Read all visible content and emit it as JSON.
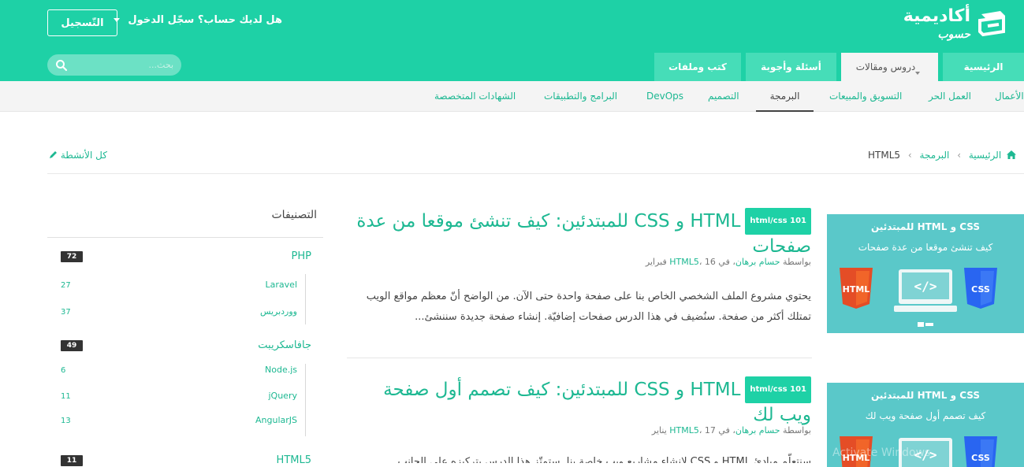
{
  "brand": {
    "name_line1": "أكاديمية",
    "name_line2": "حسوب"
  },
  "header": {
    "login_prompt": "هل لديك حساب؟ سجّل الدخول",
    "signup_label": "التّسجيل",
    "search_placeholder": "بحث..."
  },
  "main_tabs": [
    {
      "label": "الرئيسية",
      "active": false
    },
    {
      "label": "دروس ومقالات",
      "active": true
    },
    {
      "label": "أسئلة وأجوبة",
      "active": false
    },
    {
      "label": "كتب وملفات",
      "active": false
    }
  ],
  "sub_nav": [
    {
      "label": "الأعمال",
      "active": false
    },
    {
      "label": "العمل الحر",
      "active": false
    },
    {
      "label": "التسويق والمبيعات",
      "active": false
    },
    {
      "label": "البرمجة",
      "active": true
    },
    {
      "label": "التصميم",
      "active": false
    },
    {
      "label": "DevOps",
      "active": false
    },
    {
      "label": "البرامج والتطبيقات",
      "active": false
    },
    {
      "label": "الشهادات المتخصصة",
      "active": false
    }
  ],
  "breadcrumb": {
    "home": "الرئيسية",
    "section": "البرمجة",
    "current": "HTML5"
  },
  "all_activity_label": "كل الأنشطة",
  "articles": [
    {
      "tag": "html/css 101",
      "title": "HTML و CSS للمبتدئين: كيف تنشئ موقعا من عدة صفحات",
      "meta_by": "بواسطة",
      "author": "حسام برهان",
      "meta_in": "، في",
      "category": "HTML5",
      "date": "، 16 فبراير",
      "excerpt": "يحتوي مشروع الملف الشخصي الخاص بنا على صفحة واحدة حتى الآن. من الواضح أنّ معظم مواقع الويب تمتلك أكثر من صفحة. سنُضيف في هذا الدرس صفحات إضافيّة. إنشاء صفحة جديدة سننشئ...",
      "thumb_title": "CSS و HTML للمبتدئين",
      "thumb_sub": "كيف تنشئ موقعا من عدة صفحات"
    },
    {
      "tag": "html/css 101",
      "title": "HTML و CSS للمبتدئين: كيف تصمم أول صفحة ويب لك",
      "meta_by": "بواسطة",
      "author": "حسام برهان",
      "meta_in": "، في",
      "category": "HTML5",
      "date": "، 17 يناير",
      "excerpt": "سنتعلّم مبادئ HTML و CSS لإنشاء مشاريع ويب خاصة بنا. ستمتّز هذا الدرس بتركيزه على الجانب",
      "thumb_title": "CSS و HTML للمبتدئين",
      "thumb_sub": "كيف تصمم أول صفحة ويب لك"
    }
  ],
  "thumb_badges": {
    "html": "HTML",
    "css": "CSS"
  },
  "sidebar": {
    "title": "التصنيفات",
    "categories": [
      {
        "name": "PHP",
        "count": "72",
        "children": [
          {
            "name": "Laravel",
            "count": "27"
          },
          {
            "name": "ووردبريس",
            "count": "37"
          }
        ]
      },
      {
        "name": "جافاسكريبت",
        "count": "49",
        "children": [
          {
            "name": "Node.js",
            "count": "6"
          },
          {
            "name": "jQuery",
            "count": "11"
          },
          {
            "name": "AngularJS",
            "count": "13"
          }
        ]
      },
      {
        "name": "HTML5",
        "count": "11",
        "children": []
      }
    ]
  },
  "watermark": "Activate Windows",
  "colors": {
    "brand": "#1ed1a6",
    "link": "#1db892",
    "html_shield": "#e44d26",
    "css_shield": "#2965f1"
  }
}
